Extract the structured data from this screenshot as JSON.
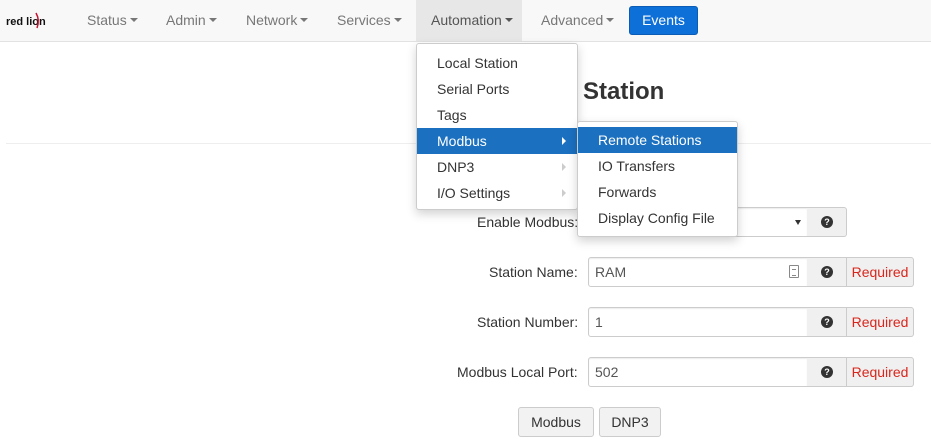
{
  "brand": {
    "logo_text": "red lion"
  },
  "navbar": {
    "items": [
      {
        "label": "Status"
      },
      {
        "label": "Admin"
      },
      {
        "label": "Network"
      },
      {
        "label": "Services"
      },
      {
        "label": "Automation"
      },
      {
        "label": "Advanced"
      }
    ],
    "events_label": "Events",
    "events_color": "#0d6fd8"
  },
  "automation_menu": {
    "items": [
      {
        "label": "Local Station"
      },
      {
        "label": "Serial Ports"
      },
      {
        "label": "Tags"
      },
      {
        "label": "Modbus"
      },
      {
        "label": "DNP3"
      },
      {
        "label": "I/O Settings"
      }
    ]
  },
  "modbus_submenu": {
    "items": [
      {
        "label": "Remote Stations"
      },
      {
        "label": "IO Transfers"
      },
      {
        "label": "Forwards"
      },
      {
        "label": "Display Config File"
      }
    ]
  },
  "page": {
    "title_visible": "Station"
  },
  "form": {
    "enable_modbus": {
      "label": "Enable Modbus:"
    },
    "station_name": {
      "label": "Station Name:",
      "value": "RAM",
      "required": "Required"
    },
    "station_number": {
      "label": "Station Number:",
      "value": "1",
      "required": "Required"
    },
    "modbus_local_port": {
      "label": "Modbus Local Port:",
      "value": "502",
      "required": "Required"
    },
    "help_glyph": "?"
  },
  "buttons": {
    "modbus": "Modbus",
    "dnp3": "DNP3"
  },
  "colors": {
    "highlight": "#1b70c0",
    "required_text": "#d9261c"
  }
}
